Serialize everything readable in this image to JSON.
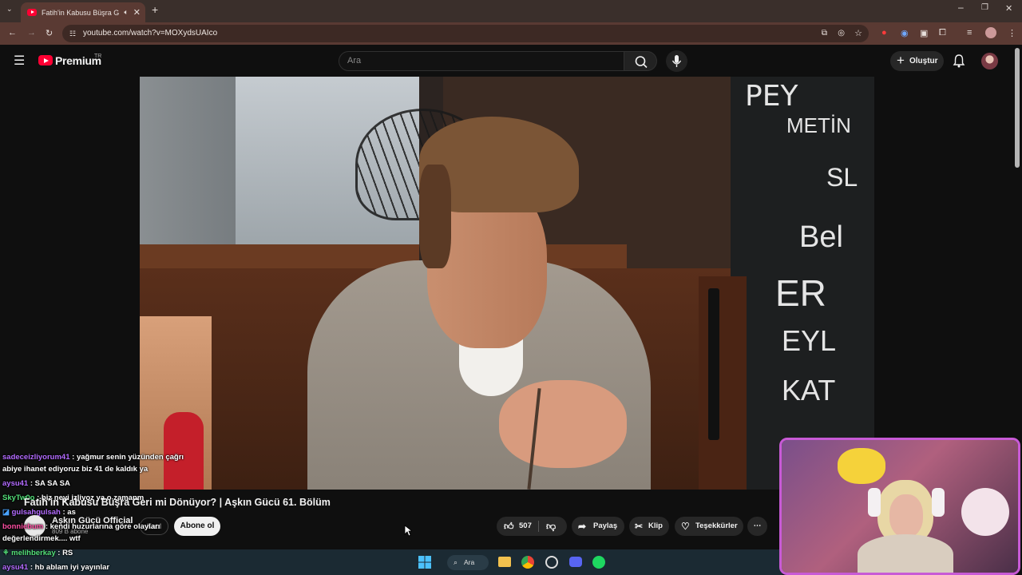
{
  "browser": {
    "tab_title": "Fatih'in Kabusu Büşra Geri m",
    "tab_close": "✕",
    "new_tab": "+",
    "url": "youtube.com/watch?v=MOXydsUAIco"
  },
  "youtube": {
    "logo_text": "Premium",
    "logo_region": "TR",
    "search_placeholder": "Ara",
    "create_label": "Oluştur"
  },
  "video": {
    "board_words": [
      "PEY",
      "METİN",
      "SL",
      "Bel",
      "ER",
      "EYL",
      "KAT"
    ]
  },
  "meta": {
    "title": "Fatih'in Kabusu Büşra Geri mi Dönüyor? | Aşkın Gücü 61. Bölüm",
    "channel_name": "Aşkın Gücü Official",
    "subscribers": "809 B abone",
    "join_label": "Katıl",
    "subscribe_label": "Abone ol",
    "like_count": "507",
    "share_label": "Paylaş",
    "clip_label": "Klip",
    "thanks_label": "Teşekkürler"
  },
  "chat": [
    {
      "user": "sadeceizliyorum41",
      "msg": ": yağmur senin yüzünden çağrı",
      "color": "purple"
    },
    {
      "user": "",
      "msg": "abiye ihanet ediyoruz biz 41 de kaldık ya",
      "color": "purple"
    },
    {
      "user": "aysu41",
      "msg": ": SA  SA  SA",
      "color": "purple"
    },
    {
      "user": "SkyTw0o",
      "msg": ": biz neyi izliyoz ya o zamanm",
      "color": "green"
    },
    {
      "user": "gulsahgulsah",
      "msg": ": as",
      "color": "purple"
    },
    {
      "user": "bonniebum",
      "msg": ": kendi huzurlarına göre olayları",
      "color": "pink"
    },
    {
      "user": "",
      "msg": "değerlendirmek.... wtf",
      "color": "pink"
    },
    {
      "user": "melihberkay",
      "msg": ": RS",
      "color": "green"
    },
    {
      "user": "aysu41",
      "msg": ": hb ablam iyi yayınlar",
      "color": "purple"
    }
  ],
  "taskbar": {
    "search_label": "Ara"
  },
  "colors": {
    "youtube_red": "#ff0033",
    "chat_purple": "#b36bff",
    "chat_green": "#54e07a",
    "chat_pink": "#ff4fa3",
    "webcam_border": "#c85ad6",
    "browser_tab": "#5a3a33"
  }
}
